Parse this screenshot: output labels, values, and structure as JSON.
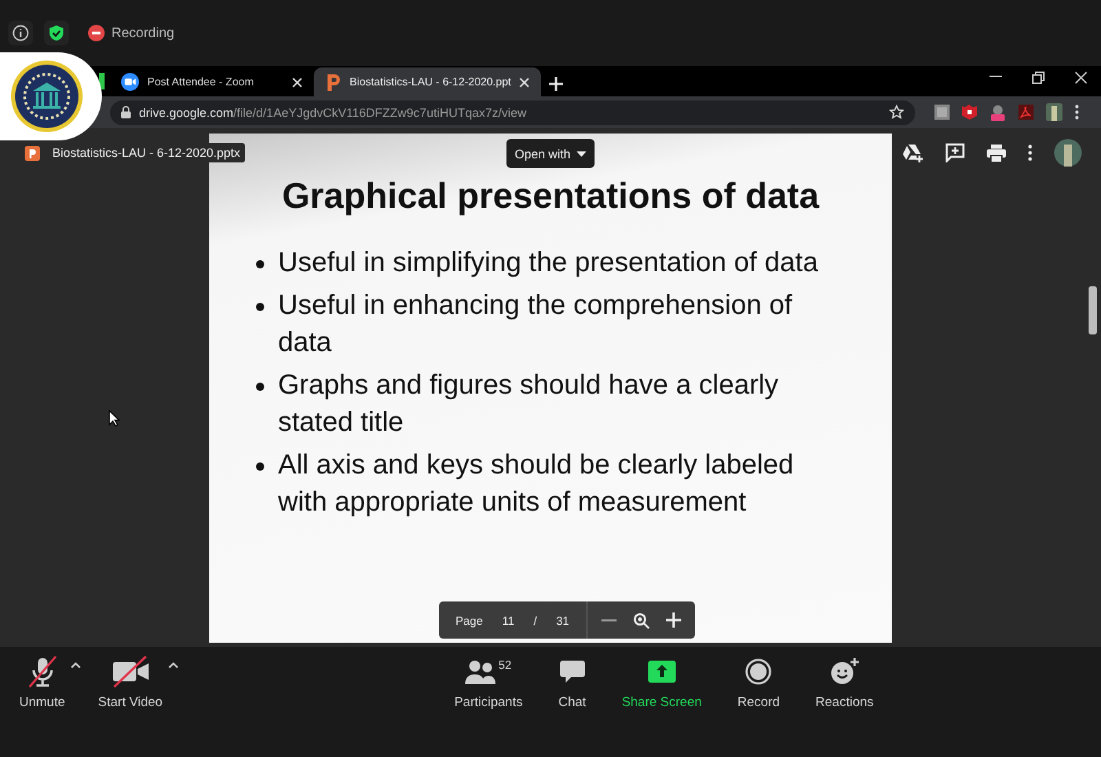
{
  "meeting_bar": {
    "recording_label": "Recording"
  },
  "browser": {
    "tabs": [
      {
        "title": "Post Attendee - Zoom",
        "kind": "zoom",
        "selected": false
      },
      {
        "title": "Biostatistics-LAU - 6-12-2020.ppt",
        "kind": "slides",
        "selected": true
      }
    ],
    "address": {
      "domain": "drive.google.com",
      "path": "/file/d/1AeYJgdvCkV116DFZZw9c7utiHUTqax7z/view"
    }
  },
  "viewer": {
    "file_name": "Biostatistics-LAU - 6-12-2020.pptx",
    "open_with": "Open with",
    "slide": {
      "title": "Graphical presentations of data",
      "bullets": [
        "Useful in simplifying the presentation of data",
        "Useful in enhancing the comprehension of data",
        "Graphs and figures should have a clearly stated title",
        "All axis and keys should be clearly labeled with appropriate units of measurement"
      ]
    },
    "page_control": {
      "label": "Page",
      "current": "11",
      "separator": "/",
      "total": "31"
    }
  },
  "toolbar": {
    "left": [
      {
        "label": "Unmute",
        "kind": "mic"
      },
      {
        "label": "Start Video",
        "kind": "video"
      }
    ],
    "center": [
      {
        "label": "Participants",
        "kind": "participants",
        "count": "52"
      },
      {
        "label": "Chat",
        "kind": "chat"
      },
      {
        "label": "Share Screen",
        "kind": "share"
      },
      {
        "label": "Record",
        "kind": "record"
      },
      {
        "label": "Reactions",
        "kind": "reactions"
      }
    ]
  }
}
